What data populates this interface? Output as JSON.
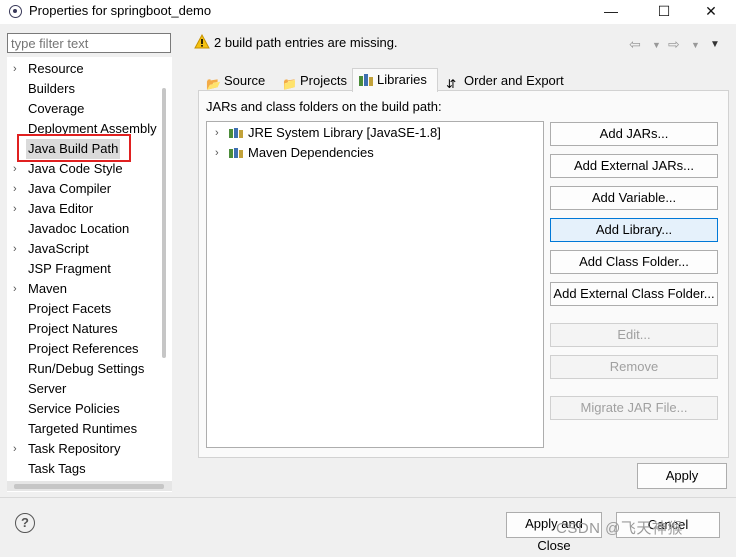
{
  "window": {
    "title": "Properties for springboot_demo",
    "min_glyph": "—",
    "max_glyph": "☐",
    "close_glyph": "✕"
  },
  "filter": {
    "placeholder": "type filter text"
  },
  "tree": {
    "items": [
      {
        "label": "Resource",
        "expandable": true
      },
      {
        "label": "Builders",
        "expandable": false
      },
      {
        "label": "Coverage",
        "expandable": false
      },
      {
        "label": "Deployment Assembly",
        "expandable": false
      },
      {
        "label": "Java Build Path",
        "expandable": false,
        "selected": true
      },
      {
        "label": "Java Code Style",
        "expandable": true
      },
      {
        "label": "Java Compiler",
        "expandable": true
      },
      {
        "label": "Java Editor",
        "expandable": true
      },
      {
        "label": "Javadoc Location",
        "expandable": false
      },
      {
        "label": "JavaScript",
        "expandable": true
      },
      {
        "label": "JSP Fragment",
        "expandable": false
      },
      {
        "label": "Maven",
        "expandable": true
      },
      {
        "label": "Project Facets",
        "expandable": false
      },
      {
        "label": "Project Natures",
        "expandable": false
      },
      {
        "label": "Project References",
        "expandable": false
      },
      {
        "label": "Run/Debug Settings",
        "expandable": false
      },
      {
        "label": "Server",
        "expandable": false
      },
      {
        "label": "Service Policies",
        "expandable": false
      },
      {
        "label": "Targeted Runtimes",
        "expandable": false
      },
      {
        "label": "Task Repository",
        "expandable": true
      },
      {
        "label": "Task Tags",
        "expandable": false
      }
    ]
  },
  "header": {
    "warning": "2 build path entries are missing."
  },
  "tabs": [
    {
      "label": "Source",
      "icon": "source-icon"
    },
    {
      "label": "Projects",
      "icon": "projects-icon"
    },
    {
      "label": "Libraries",
      "icon": "libraries-icon",
      "active": true
    },
    {
      "label": "Order and Export",
      "icon": "order-export-icon"
    }
  ],
  "libraries": {
    "heading": "JARs and class folders on the build path:",
    "entries": [
      {
        "label": "JRE System Library [JavaSE-1.8]"
      },
      {
        "label": "Maven Dependencies"
      }
    ]
  },
  "buttons": {
    "add_jars": "Add JARs...",
    "add_external_jars": "Add External JARs...",
    "add_variable": "Add Variable...",
    "add_library": "Add Library...",
    "add_class_folder": "Add Class Folder...",
    "add_external_class_folder": "Add External Class Folder...",
    "edit": "Edit...",
    "remove": "Remove",
    "migrate_jar": "Migrate JAR File...",
    "apply": "Apply",
    "apply_and_close": "Apply and Close",
    "cancel": "Cancel"
  },
  "help_glyph": "?",
  "watermark": "CSDN @飞天神猴",
  "colors": {
    "highlight_box": "#e02020",
    "accent": "#0078d7"
  }
}
